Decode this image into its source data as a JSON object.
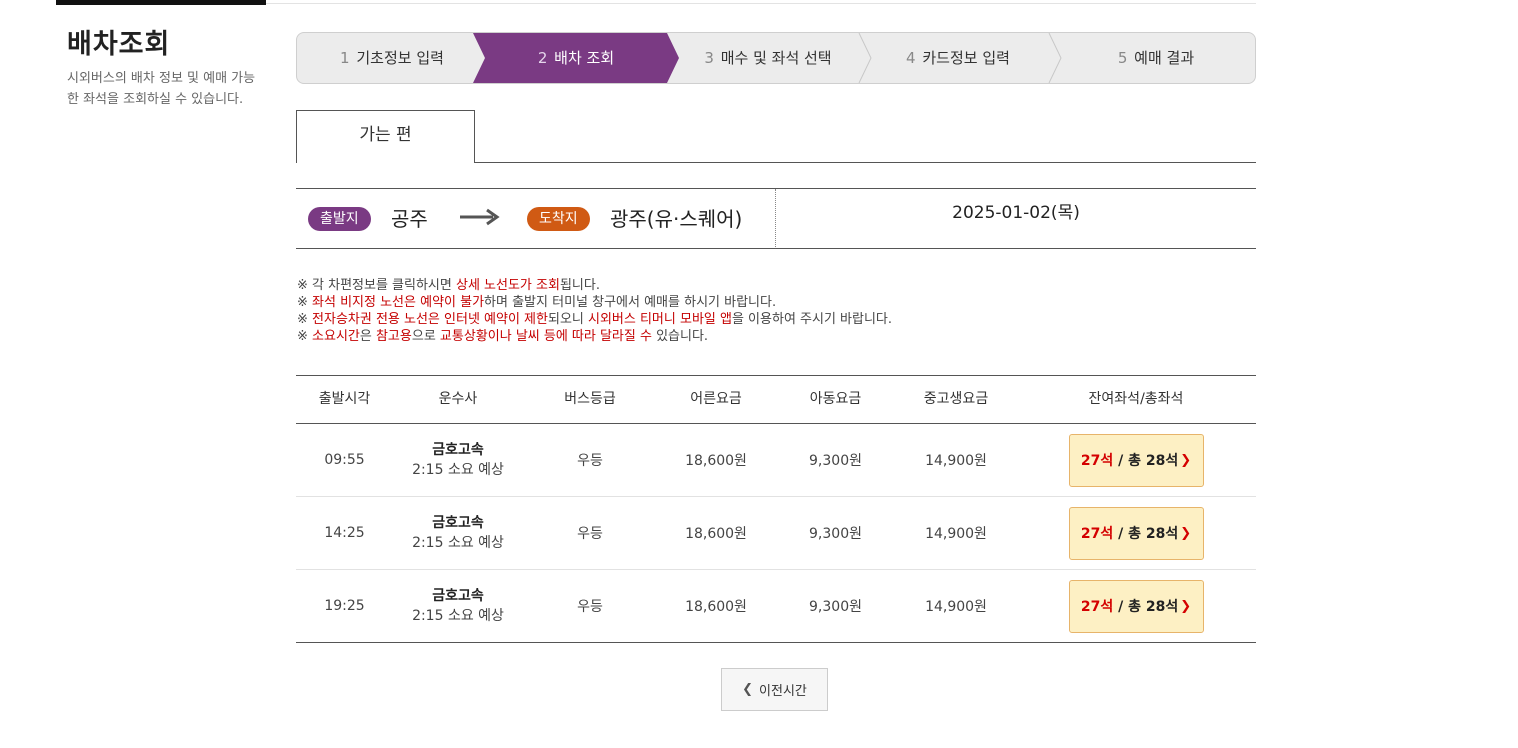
{
  "sidebar": {
    "title": "배차조회",
    "description": "시외버스의 배차 정보 및 예매 가능한 좌석을 조회하실 수 있습니다."
  },
  "steps": [
    {
      "num": "1",
      "label": "기초정보 입력",
      "active": false
    },
    {
      "num": "2",
      "label": "배차 조회",
      "active": true
    },
    {
      "num": "3",
      "label": "매수 및 좌석 선택",
      "active": false
    },
    {
      "num": "4",
      "label": "카드정보 입력",
      "active": false
    },
    {
      "num": "5",
      "label": "예매 결과",
      "active": false
    }
  ],
  "colors": {
    "active_step": "#7a3a83",
    "departure_badge": "#7a3a83",
    "arrival_badge": "#d05a14",
    "highlight_text": "#c40000",
    "seat_button_bg": "#fdf0c4"
  },
  "tab": {
    "label": "가는 편"
  },
  "route": {
    "departure_label": "출발지",
    "departure": "공주",
    "arrival_label": "도착지",
    "arrival": "광주(유·스퀘어)",
    "arrow_icon": "arrow-right-icon",
    "date": "2025-01-02(목)"
  },
  "notices": [
    {
      "parts": [
        {
          "t": "※ 각 차편정보를 클릭하시면 "
        },
        {
          "t": "상세 노선도가 조회",
          "hl": true
        },
        {
          "t": "됩니다."
        }
      ]
    },
    {
      "parts": [
        {
          "t": "※ "
        },
        {
          "t": "좌석 비지정 노선은 예약이 불가",
          "hl": true
        },
        {
          "t": "하며 출발지 터미널 창구에서 예매를 하시기 바랍니다."
        }
      ]
    },
    {
      "parts": [
        {
          "t": "※ "
        },
        {
          "t": "전자승차권 전용 노선은 인터넷 예약이 제한",
          "hl": true
        },
        {
          "t": "되오니 "
        },
        {
          "t": "시외버스 티머니 모바일 앱",
          "hl": true
        },
        {
          "t": "을 이용하여 주시기 바랍니다."
        }
      ]
    },
    {
      "parts": [
        {
          "t": "※ "
        },
        {
          "t": "소요시간",
          "hl": true
        },
        {
          "t": "은 "
        },
        {
          "t": "참고용",
          "hl": true
        },
        {
          "t": "으로 "
        },
        {
          "t": "교통상황이나 날씨 등에 따라 달라질 수",
          "hl": true
        },
        {
          "t": " 있습니다."
        }
      ]
    }
  ],
  "table": {
    "headers": [
      "출발시각",
      "운수사",
      "버스등급",
      "어른요금",
      "아동요금",
      "중고생요금",
      "잔여좌석/총좌석"
    ],
    "rows": [
      {
        "time": "09:55",
        "company": "금호고속",
        "duration": "2:15 소요 예상",
        "grade": "우등",
        "adult": "18,600원",
        "child": "9,300원",
        "student": "14,900원",
        "remaining": "27석",
        "total": "/ 총 28석"
      },
      {
        "time": "14:25",
        "company": "금호고속",
        "duration": "2:15 소요 예상",
        "grade": "우등",
        "adult": "18,600원",
        "child": "9,300원",
        "student": "14,900원",
        "remaining": "27석",
        "total": "/ 총 28석"
      },
      {
        "time": "19:25",
        "company": "금호고속",
        "duration": "2:15 소요 예상",
        "grade": "우등",
        "adult": "18,600원",
        "child": "9,300원",
        "student": "14,900원",
        "remaining": "27석",
        "total": "/ 총 28석"
      }
    ]
  },
  "prev_button": {
    "label": "이전시간",
    "icon": "chevron-left-icon"
  }
}
